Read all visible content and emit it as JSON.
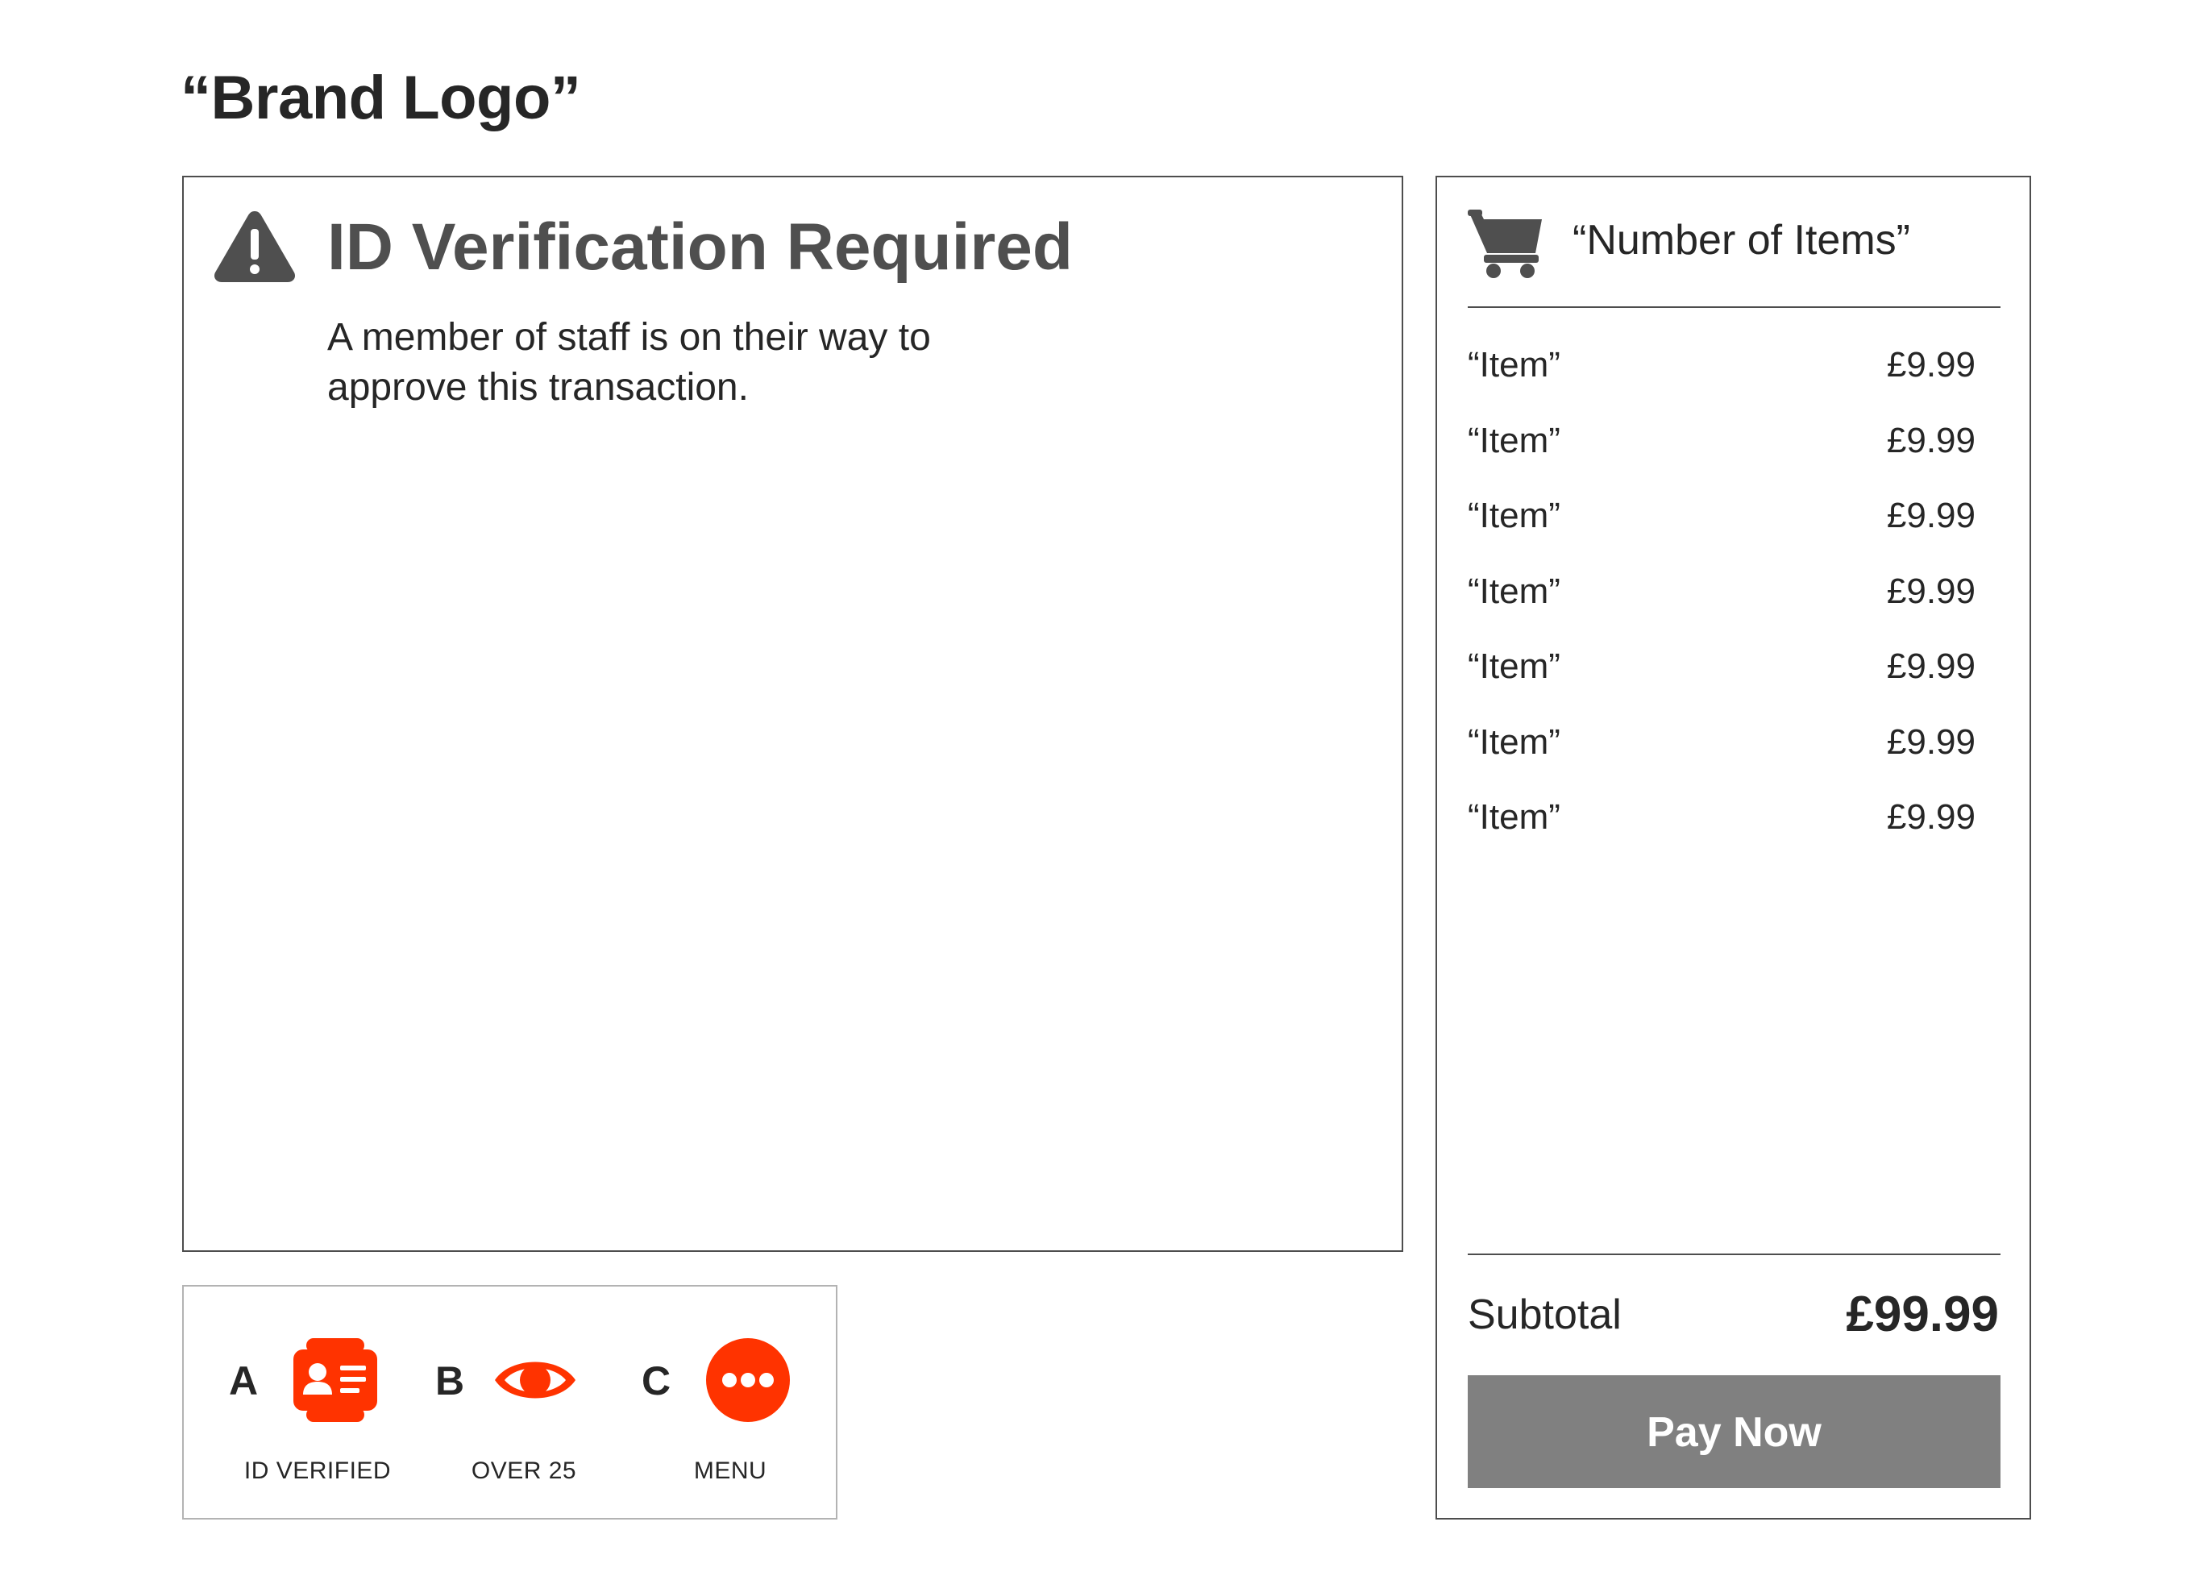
{
  "brand": {
    "logo_text": "“Brand Logo”"
  },
  "alert": {
    "icon": "warning-triangle-icon",
    "title": "ID Verification Required",
    "message": "A member of staff is on their way to approve this transaction."
  },
  "keys": [
    {
      "letter": "A",
      "icon": "id-card-icon",
      "label": "ID VERIFIED"
    },
    {
      "letter": "B",
      "icon": "eye-icon",
      "label": "OVER 25"
    },
    {
      "letter": "C",
      "icon": "more-dots-icon",
      "label": "MENU"
    }
  ],
  "cart": {
    "icon": "shopping-cart-icon",
    "count_label": "“Number of Items”",
    "items": [
      {
        "name": "“Item”",
        "price": "£9.99"
      },
      {
        "name": "“Item”",
        "price": "£9.99"
      },
      {
        "name": "“Item”",
        "price": "£9.99"
      },
      {
        "name": "“Item”",
        "price": "£9.99"
      },
      {
        "name": "“Item”",
        "price": "£9.99"
      },
      {
        "name": "“Item”",
        "price": "£9.99"
      },
      {
        "name": "“Item”",
        "price": "£9.99"
      }
    ],
    "subtotal_label": "Subtotal",
    "subtotal_value": "£99.99",
    "pay_button_label": "Pay Now"
  },
  "colors": {
    "accent": "#ff3300",
    "heading_gray": "#4f4f4f",
    "button_gray": "#808080",
    "border_dark": "#4d4d4d",
    "border_light": "#b3b3b3",
    "text": "#262626"
  }
}
